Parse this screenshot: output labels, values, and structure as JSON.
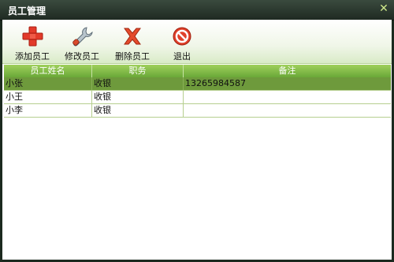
{
  "window": {
    "title": "员工管理",
    "close_glyph": "✕"
  },
  "toolbar": {
    "items": [
      {
        "label": "添加员工",
        "icon": "plus-icon"
      },
      {
        "label": "修改员工",
        "icon": "wrench-icon"
      },
      {
        "label": "删除员工",
        "icon": "delete-x-icon"
      },
      {
        "label": "退出",
        "icon": "exit-icon"
      }
    ]
  },
  "table": {
    "columns": [
      "员工姓名",
      "职务",
      "备注"
    ],
    "rows": [
      [
        "小张",
        "收银",
        "13265984587"
      ],
      [
        "小王",
        "收银",
        ""
      ],
      [
        "小李",
        "收银",
        ""
      ]
    ],
    "selected_row": 0
  },
  "colors": {
    "accent": "#6aa838",
    "selected_row": "#6e9a3c",
    "title_bar": "#1f2a22"
  }
}
